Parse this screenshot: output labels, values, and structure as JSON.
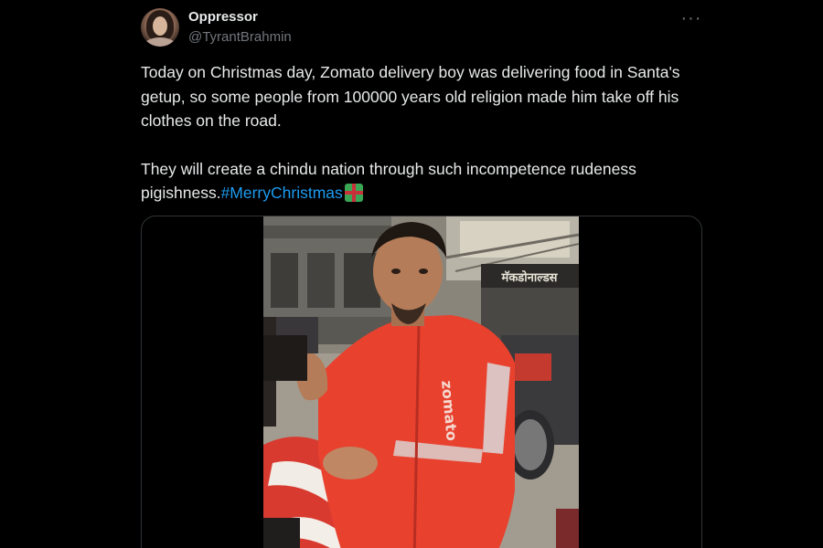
{
  "tweet": {
    "display_name": "Oppressor",
    "handle": "@TyrantBrahmin",
    "more_label": "···",
    "text_line1": "Today on Christmas day, Zomato delivery boy was delivering food in Santa's getup, so some people from 100000 years old religion made him take off his clothes on the road.",
    "text_line2": "They will create a chindu nation through such incompetence rudeness pigishness.",
    "hashtag": "#MerryChristmas",
    "emoji_icon": "wrapped-gift-icon"
  },
  "media": {
    "type": "video",
    "sign_text": "मॅकडोनाल्डस"
  },
  "colors": {
    "background": "#000000",
    "text": "#e7e9ea",
    "secondary": "#71767b",
    "link": "#1d9bf0",
    "border": "#2f3336",
    "jacket_red": "#e8412e"
  }
}
